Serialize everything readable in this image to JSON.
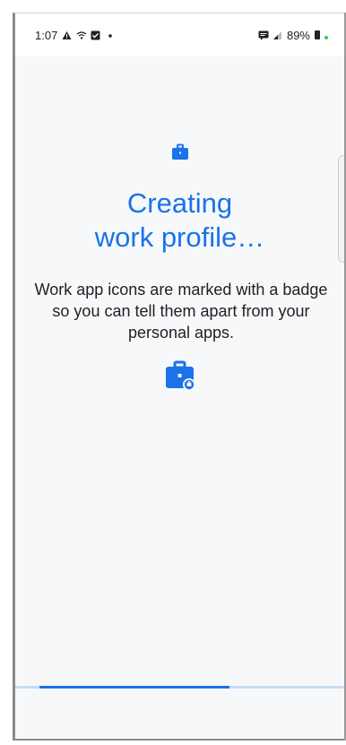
{
  "status_bar": {
    "time": "1:07",
    "notification_icons": [
      "warning-icon",
      "wifi-calling-icon",
      "checkbox-icon",
      "dot-icon"
    ],
    "battery_text": "89%",
    "right_icons": [
      "messages-icon",
      "signal-icon",
      "battery-icon",
      "charging-dot-icon"
    ]
  },
  "setup": {
    "title_line1": "Creating",
    "title_line2": "work profile…",
    "description": "Work app icons are marked with a badge so you can tell them apart from your personal apps.",
    "progress_fraction": 0.65
  },
  "colors": {
    "accent": "#1a73e8",
    "background": "#f7f8fa",
    "text": "#202124",
    "progress_track": "#c9daf5"
  }
}
